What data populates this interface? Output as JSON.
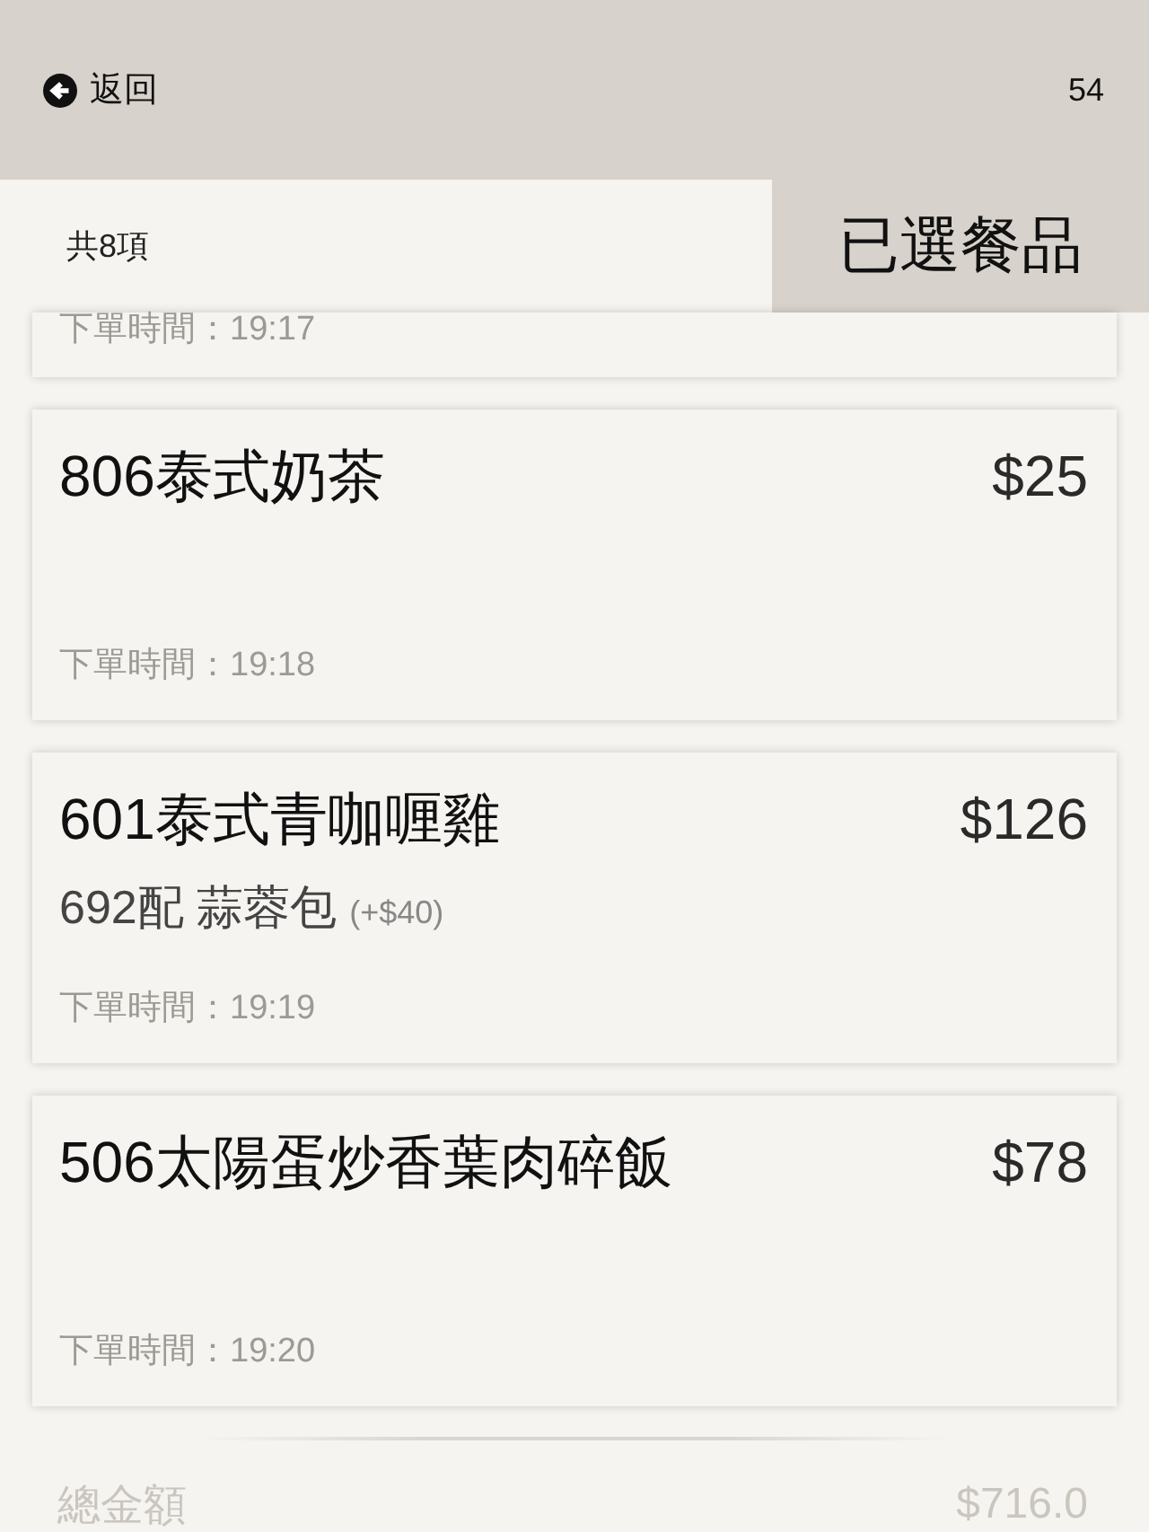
{
  "header": {
    "back_label": "返回",
    "number": "54"
  },
  "summary": {
    "count": "共8項",
    "title": "已選餐品"
  },
  "items": [
    {
      "time": "下單時間：19:17"
    },
    {
      "name": "806泰式奶茶",
      "price": "$25",
      "time": "下單時間：19:18"
    },
    {
      "name": "601泰式青咖喱雞",
      "price": "$126",
      "options": [
        {
          "label": "692配 蒜蓉包",
          "surcharge": "(+$40)"
        }
      ],
      "time": "下單時間：19:19"
    },
    {
      "name": "506太陽蛋炒香葉肉碎飯",
      "price": "$78",
      "time": "下單時間：19:20"
    }
  ],
  "total": {
    "label": "總金額",
    "amount": "$716.0"
  }
}
